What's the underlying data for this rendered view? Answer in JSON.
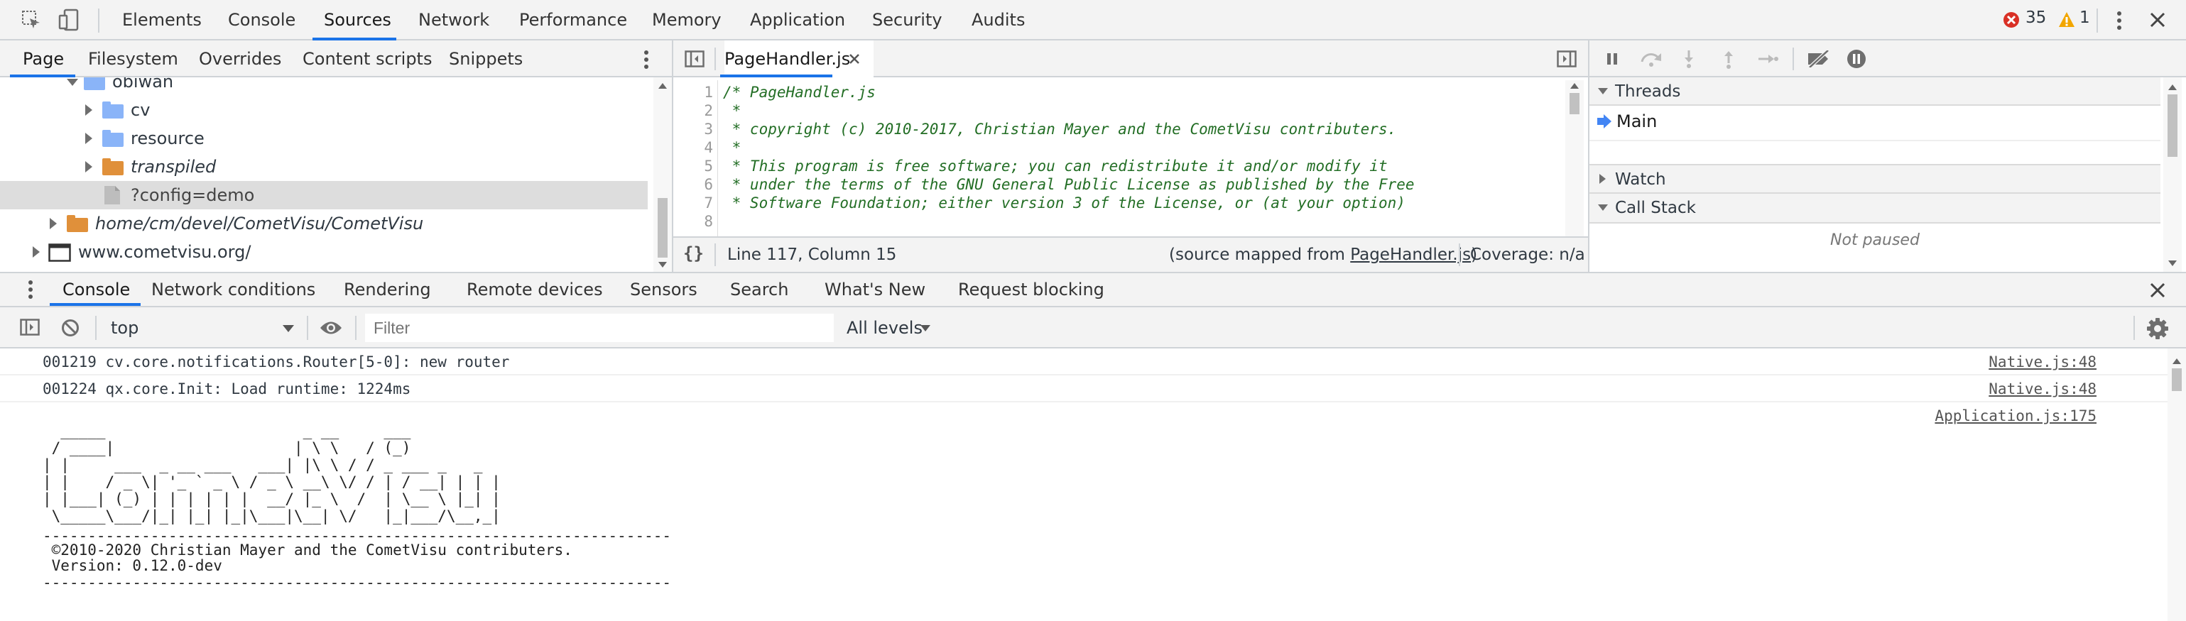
{
  "toolbar": {
    "tabs": [
      "Elements",
      "Console",
      "Sources",
      "Network",
      "Performance",
      "Memory",
      "Application",
      "Security",
      "Audits"
    ],
    "active_tab": "Sources",
    "error_count": "35",
    "warning_count": "1"
  },
  "navigator": {
    "tabs": [
      "Page",
      "Filesystem",
      "Overrides",
      "Content scripts",
      "Snippets"
    ],
    "active_tab": "Page",
    "tree": [
      {
        "label": "obiwan",
        "type": "folder-blue",
        "indent": 2,
        "expanded": true
      },
      {
        "label": "cv",
        "type": "folder-blue",
        "indent": 3,
        "expanded": false
      },
      {
        "label": "resource",
        "type": "folder-blue",
        "indent": 3,
        "expanded": false
      },
      {
        "label": "transpiled",
        "type": "folder-orange",
        "indent": 3,
        "expanded": false,
        "italic": true
      },
      {
        "label": "?config=demo",
        "type": "file",
        "indent": 3,
        "selected": true
      },
      {
        "label": "home/cm/devel/CometVisu/CometVisu",
        "type": "folder-orange",
        "indent": 1,
        "expanded": false,
        "italic": true
      },
      {
        "label": "www.cometvisu.org/",
        "type": "frame",
        "indent": 0,
        "expanded": false
      }
    ]
  },
  "editor": {
    "file_tab": "PageHandler.js",
    "lines": [
      {
        "n": "1",
        "text": "/* PageHandler.js"
      },
      {
        "n": "2",
        "text": " *"
      },
      {
        "n": "3",
        "text": " * copyright (c) 2010-2017, Christian Mayer and the CometVisu contributers."
      },
      {
        "n": "4",
        "text": " *"
      },
      {
        "n": "5",
        "text": " * This program is free software; you can redistribute it and/or modify it"
      },
      {
        "n": "6",
        "text": " * under the terms of the GNU General Public License as published by the Free"
      },
      {
        "n": "7",
        "text": " * Software Foundation; either version 3 of the License, or (at your option)"
      },
      {
        "n": "8",
        "text": ""
      }
    ],
    "status_position": "Line 117, Column 15",
    "source_mapped_prefix": "(source mapped from ",
    "source_mapped_file": "PageHandler.js",
    "source_mapped_suffix": ")",
    "coverage": "Coverage: n/a",
    "format_icon_label": "{}"
  },
  "debugger": {
    "threads_label": "Threads",
    "main_thread": "Main",
    "watch_label": "Watch",
    "call_stack_label": "Call Stack",
    "not_paused": "Not paused"
  },
  "drawer": {
    "tabs": [
      "Console",
      "Network conditions",
      "Rendering",
      "Remote devices",
      "Sensors",
      "Search",
      "What's New",
      "Request blocking"
    ],
    "active_tab": "Console",
    "context": "top",
    "filter_placeholder": "Filter",
    "levels": "All levels"
  },
  "console": {
    "messages": [
      {
        "text": "001219 cv.core.notifications.Router[5-0]: new router",
        "source": "Native.js:48"
      },
      {
        "text": "001224 qx.core.Init: Load runtime: 1224ms",
        "source": "Native.js:48"
      }
    ],
    "banner_source": "Application.js:175",
    "banner_ascii": [
      "  _____                      _ __     ___",
      " / ____|                    | \\ \\   / (_)",
      "| |     ___  _ __ ___   ___| |\\ \\ / / _ ___ _   _",
      "| |    / _ \\| '_ ` _ \\ / _ \\ __\\ \\/ / | / __| | | |",
      "| |___| (_) | | | | | |  __/ |_ \\  /  | \\__ \\ |_| |",
      " \\_____\\___/|_| |_| |_|\\___|\\__| \\/   |_|___/\\__,_|"
    ],
    "divider": "----------------------------------------------------------------------",
    "copyright": " ©2010-2020 Christian Mayer and the CometVisu contributers.",
    "version": " Version: 0.12.0-dev"
  },
  "colors": {
    "accent": "#1a73e8",
    "error": "#d93025",
    "warning": "#f2a600",
    "comment": "#236e25",
    "selected_row": "#dddddd"
  }
}
